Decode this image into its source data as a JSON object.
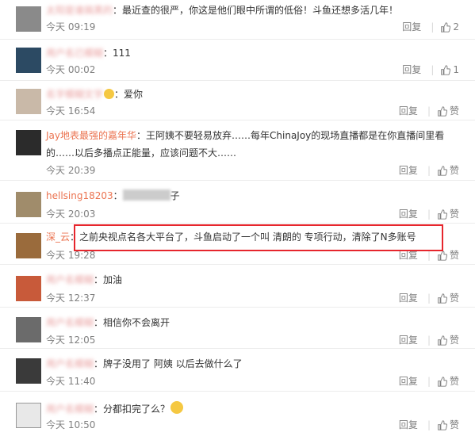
{
  "comments": [
    {
      "user": "太阳是谁搞黑的",
      "blurred": true,
      "text": "最近查的很严，你这是他们眼中所谓的低俗！斗鱼还想多活几年！",
      "time": "今天 09:19",
      "reply": "回复",
      "like": "2",
      "avatar": "#8a8a8a"
    },
    {
      "user": "用户名已模糊",
      "blurred": true,
      "text": "111",
      "time": "今天 00:02",
      "reply": "回复",
      "like": "1",
      "avatar": "#2c4a63"
    },
    {
      "user": "名字模糊文字",
      "blurred": true,
      "text": "爱你",
      "time": "今天 16:54",
      "reply": "回复",
      "like": "赞",
      "avatar": "#c9b9a8"
    },
    {
      "user": "Jay地表最强的嘉年华",
      "blurred": false,
      "text": "王阿姨不要轻易放弃……每年ChinaJoy的现场直播都是在你直播间里看的……以后多播点正能量，应该问题不大……",
      "line1": "王阿姨不要轻易放弃……每年ChinaJoy的现场直播都是在你直播间里看",
      "line2": "的……以后多播点正能量，应该问题不大……",
      "time": "今天 20:39",
      "reply": "回复",
      "like": "赞",
      "avatar": "#2b2b2b"
    },
    {
      "user": "hellsing18203",
      "blurred": false,
      "text": "子",
      "time": "今天 20:03",
      "reply": "回复",
      "like": "赞",
      "avatar": "#a08c6b"
    },
    {
      "user": "深_云",
      "blurred": false,
      "text": "之前央视点名各大平台了，斗鱼启动了一个叫 清朗的 专项行动，清除了N多账号",
      "time": "今天 19:28",
      "reply": "回复",
      "like": "赞",
      "avatar": "#9a6b3c"
    },
    {
      "user": "用户名模糊",
      "blurred": true,
      "text": "加油",
      "time": "今天 12:37",
      "reply": "回复",
      "like": "赞",
      "avatar": "#c85a3a"
    },
    {
      "user": "用户名模糊",
      "blurred": true,
      "text": "相信你不会离开",
      "time": "今天 12:05",
      "reply": "回复",
      "like": "赞",
      "avatar": "#6b6b6b"
    },
    {
      "user": "用户名模糊",
      "blurred": true,
      "text": "牌子没用了  阿姨 以后去做什么了",
      "time": "今天 11:40",
      "reply": "回复",
      "like": "赞",
      "avatar": "#3a3a3a"
    },
    {
      "user": "用户名模糊",
      "blurred": true,
      "text": "分都扣完了么？",
      "time": "今天 10:50",
      "reply": "回复",
      "like": "赞",
      "avatar": "#e8e8e8"
    }
  ],
  "colors": {
    "username": "#eb7350",
    "highlight_box": "#e6262d",
    "meta": "#808080"
  },
  "icons": {
    "like": "thumbs-up-icon",
    "emoji": "smiley-icon"
  }
}
